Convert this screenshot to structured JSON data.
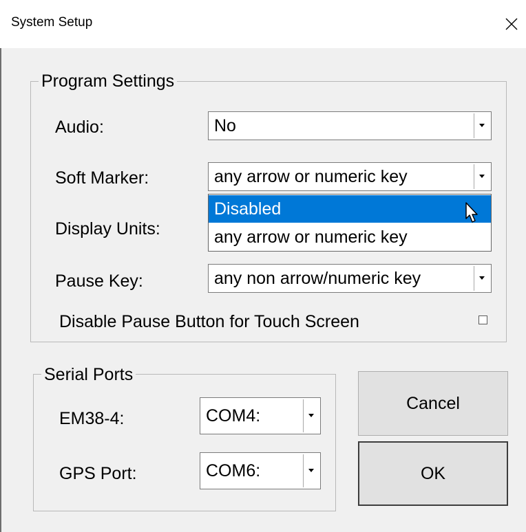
{
  "window": {
    "title": "System Setup",
    "close_glyph": "✕"
  },
  "program_settings": {
    "legend": "Program Settings",
    "audio": {
      "label": "Audio:",
      "value": "No"
    },
    "soft_marker": {
      "label": "Soft Marker:",
      "value": "any arrow or numeric key",
      "dropdown_open": true,
      "options": [
        "Disabled",
        "any arrow or numeric key"
      ],
      "highlighted_option": "Disabled"
    },
    "display_units": {
      "label": "Display Units:"
    },
    "pause_key": {
      "label": "Pause Key:",
      "value": "any non arrow/numeric key"
    },
    "disable_pause_touch": {
      "label": "Disable Pause Button for Touch Screen",
      "checked": false
    }
  },
  "serial_ports": {
    "legend": "Serial Ports",
    "em38": {
      "label": "EM38-4:",
      "value": "COM4:"
    },
    "gps": {
      "label": "GPS Port:",
      "value": "COM6:"
    }
  },
  "buttons": {
    "cancel_label": "Cancel",
    "ok_label": "OK"
  },
  "colors": {
    "selection": "#0078d7",
    "dialog_bg": "#f0f0f0",
    "title_bg": "#ffffff"
  }
}
